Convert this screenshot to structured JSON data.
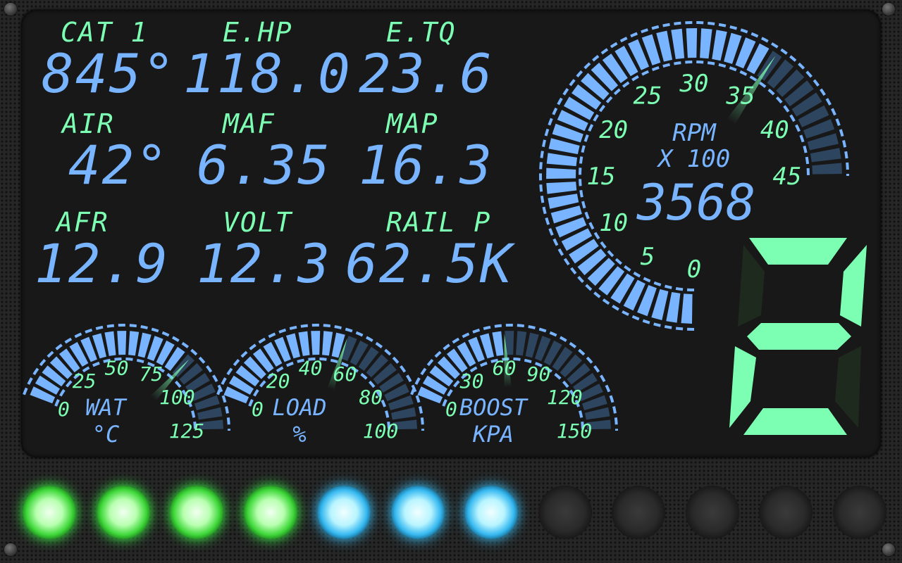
{
  "readouts": [
    {
      "label": "CAT 1",
      "value": "845°"
    },
    {
      "label": "E.HP",
      "value": "118.0"
    },
    {
      "label": "E.TQ",
      "value": "23.6"
    },
    {
      "label": "AIR",
      "value": "42°"
    },
    {
      "label": "MAF",
      "value": "6.35"
    },
    {
      "label": "MAP",
      "value": "16.3"
    },
    {
      "label": "AFR",
      "value": "12.9"
    },
    {
      "label": "VOLT",
      "value": "12.3"
    },
    {
      "label": "RAIL P",
      "value": "62.5K"
    }
  ],
  "rpm_gauge": {
    "label": "RPM",
    "unit": "X 100",
    "value_text": "3568",
    "value": 35.68,
    "max": 45,
    "ticks": [
      "0",
      "5",
      "10",
      "15",
      "20",
      "25",
      "30",
      "35",
      "40",
      "45"
    ]
  },
  "small_gauges": [
    {
      "label": "WAT",
      "unit": "°C",
      "value": 88,
      "max": 125,
      "ticks": [
        "0",
        "25",
        "50",
        "75",
        "100",
        "125"
      ]
    },
    {
      "label": "LOAD",
      "unit": "%",
      "value": 55,
      "max": 100,
      "ticks": [
        "0",
        "20",
        "40",
        "60",
        "80",
        "100"
      ]
    },
    {
      "label": "BOOST",
      "unit": "KPA",
      "value": 62,
      "max": 150,
      "ticks": [
        "0",
        "30",
        "60",
        "90",
        "120",
        "150"
      ]
    }
  ],
  "gear": "2",
  "shift_lights": [
    "green",
    "green",
    "green",
    "green",
    "cyan",
    "cyan",
    "cyan",
    "off",
    "off",
    "off",
    "off",
    "off"
  ],
  "colors": {
    "accent_blue": "#78b4ff",
    "accent_green": "#7dffb3",
    "dim_segment": "#2e4560",
    "panel": "#181818"
  }
}
